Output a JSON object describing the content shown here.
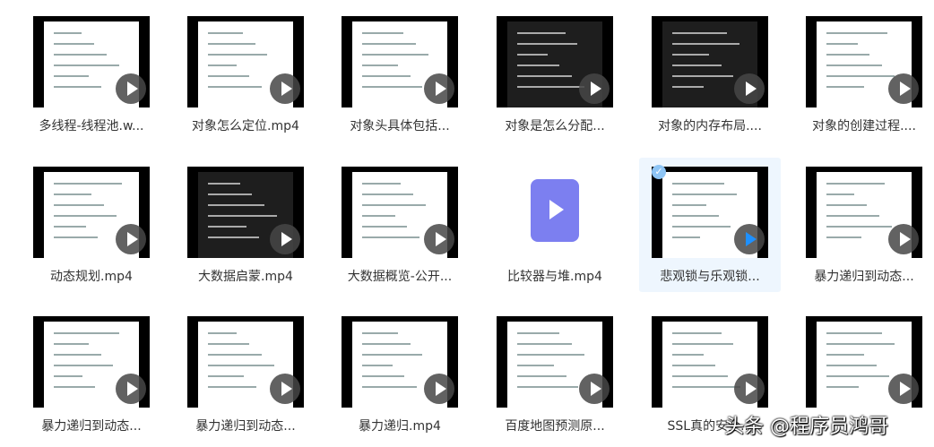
{
  "files": [
    {
      "name": "多线程-线程池.w..."
    },
    {
      "name": "对象怎么定位.mp4"
    },
    {
      "name": "对象头具体包括..."
    },
    {
      "name": "对象是怎么分配..."
    },
    {
      "name": "对象的内存布局...."
    },
    {
      "name": "对象的创建过程...."
    },
    {
      "name": "动态规划.mp4"
    },
    {
      "name": "大数据启蒙.mp4"
    },
    {
      "name": "大数据概览-公开..."
    },
    {
      "name": "比较器与堆.mp4"
    },
    {
      "name": "悲观锁与乐观锁...",
      "selected": true
    },
    {
      "name": "暴力递归到动态..."
    },
    {
      "name": "暴力递归到动态..."
    },
    {
      "name": "暴力递归到动态..."
    },
    {
      "name": "暴力递归.mp4"
    },
    {
      "name": "百度地图预测原..."
    },
    {
      "name": "SSL真的安全..."
    },
    {
      "name": ""
    }
  ],
  "selected_check": "✓",
  "watermark": "头条 @程序员鸿哥"
}
